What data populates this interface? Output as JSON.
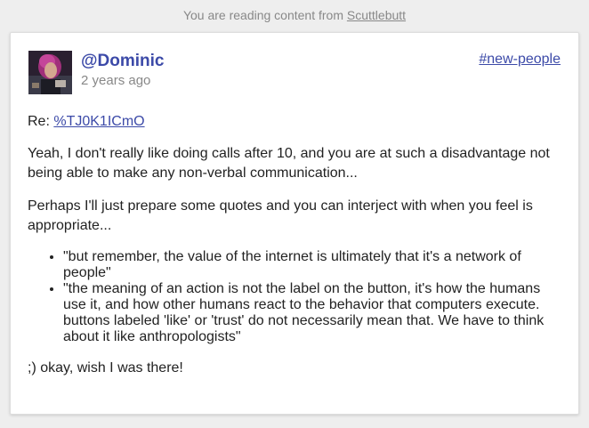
{
  "notice": {
    "prefix": "You are reading content from ",
    "link": "Scuttlebutt"
  },
  "post": {
    "author": "@Dominic",
    "timestamp": "2 years ago",
    "channel": "#new-people",
    "reply_prefix": "Re: ",
    "reply_link": "%TJ0K1ICmO",
    "paragraphs": [
      "Yeah, I don't really like doing calls after 10, and you are at such a disadvantage not being able to make any non-verbal communication...",
      "Perhaps I'll just prepare some quotes and you can interject with when you feel is appropriate..."
    ],
    "quotes": [
      "\"but remember, the value of the internet is ultimately that it's a network of people\"",
      "\"the meaning of an action is not the label on the button, it's how the humans use it, and how other humans react to the behavior that computers execute. buttons labeled 'like' or 'trust' do not necessarily mean that. We have to think about it like anthropologists\""
    ],
    "closing": ";) okay, wish I was there!"
  },
  "colors": {
    "link": "#3c4aa8",
    "muted": "#888888",
    "background": "#eeeeee",
    "card": "#ffffff"
  }
}
